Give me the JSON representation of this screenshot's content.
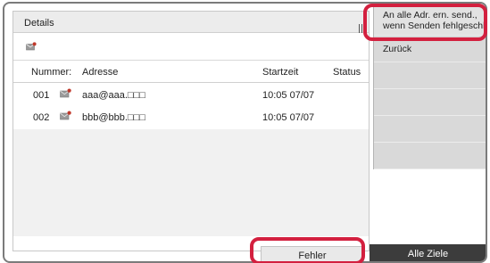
{
  "header": {
    "title": "Details"
  },
  "table": {
    "columns": {
      "number": "Nummer:",
      "address": "Adresse",
      "start_time": "Startzeit",
      "status": "Status"
    },
    "rows": [
      {
        "number": "001",
        "address": "aaa@aaa.□□□",
        "start_time": "10:05 07/07",
        "status": ""
      },
      {
        "number": "002",
        "address": "bbb@bbb.□□□",
        "start_time": "10:05 07/07",
        "status": ""
      }
    ]
  },
  "side_menu": {
    "resend_line1": "An alle Adr. ern. send.,",
    "resend_line2": "wenn Senden fehlgeschl.",
    "back": "Zurück"
  },
  "footer": {
    "error_button": "Fehler",
    "all_targets_button": "Alle Ziele"
  },
  "icons": {
    "mail": "mail-icon"
  },
  "colors": {
    "highlight_ring": "#d3203f",
    "dark_button": "#3c3c3c"
  }
}
